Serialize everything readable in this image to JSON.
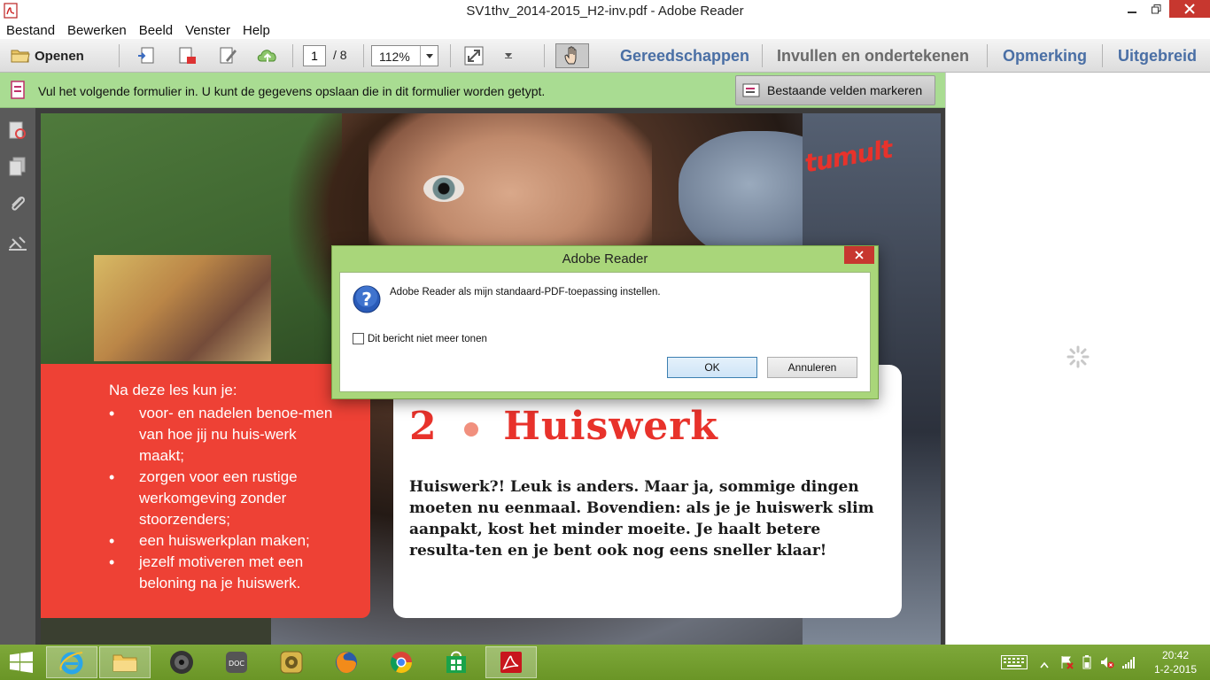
{
  "window": {
    "title": "SV1thv_2014-2015_H2-inv.pdf - Adobe Reader"
  },
  "menubar": {
    "items": [
      "Bestand",
      "Bewerken",
      "Beeld",
      "Venster",
      "Help"
    ]
  },
  "toolbar": {
    "open_label": "Openen",
    "page_current": "1",
    "page_total": "/ 8",
    "zoom": "112%",
    "panes": [
      "Gereedschappen",
      "Invullen en ondertekenen",
      "Opmerking",
      "Uitgebreid"
    ]
  },
  "formbar": {
    "message": "Vul het volgende formulier in. U kunt de gegevens opslaan die in dit formulier worden getypt.",
    "highlight_label": "Bestaande velden markeren"
  },
  "document": {
    "logo": "tumult",
    "goals_title": "Na deze les kun je:",
    "goals": [
      "voor- en nadelen benoe-men van hoe jij nu huis-werk maakt;",
      "zorgen voor een rustige werkomgeving zonder stoorzenders;",
      "een huiswerkplan maken;",
      "jezelf motiveren met een beloning na je huiswerk."
    ],
    "chapter_number": "2",
    "chapter_title": "Huiswerk",
    "intro": "Huiswerk?! Leuk is anders. Maar ja, sommige dingen moeten nu eenmaal. Bovendien: als je je huiswerk slim aanpakt, kost het minder moeite. Je haalt betere resulta-ten en je bent ook nog eens sneller klaar!"
  },
  "dialog": {
    "title": "Adobe Reader",
    "message": "Adobe Reader als mijn standaard-PDF-toepassing instellen.",
    "checkbox_label": "Dit bericht niet meer tonen",
    "ok_label": "OK",
    "cancel_label": "Annuleren"
  },
  "taskbar": {
    "apps": [
      "internet-explorer",
      "file-explorer",
      "media-player",
      "doc-viewer",
      "app-settings",
      "firefox",
      "chrome",
      "store",
      "adobe-reader"
    ],
    "time": "20:42",
    "date": "1-2-2015"
  },
  "colors": {
    "accent_green": "#a9dc92",
    "pane_tab_blue": "#4a6fa5",
    "doc_red": "#ee4135",
    "close_red": "#c7372f",
    "taskbar_green": "#74a030"
  }
}
